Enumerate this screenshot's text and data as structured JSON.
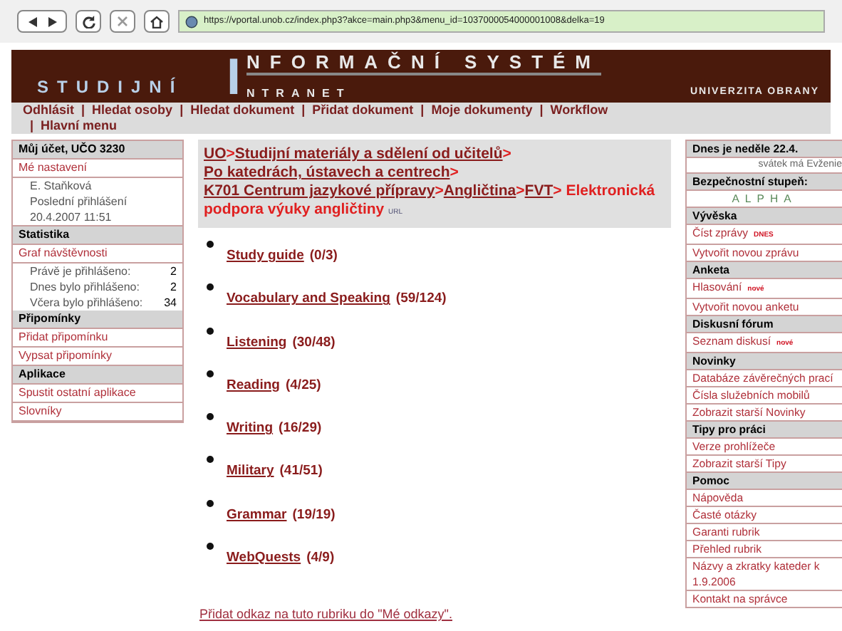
{
  "browser": {
    "url": "https://vportal.unob.cz/index.php3?akce=main.php3&menu_id=1037000054000001008&delka=19"
  },
  "banner": {
    "left": "STUDIJNÍ",
    "big_letter": "I",
    "top": "NFORMAČNÍ SYSTÉM",
    "bottom": "NTRANET",
    "right": "UNIVERZITA OBRANY"
  },
  "menu_separator": "|",
  "menu": [
    "Odhlásit",
    "Hledat osoby",
    "Hledat dokument",
    "Přidat dokument",
    "Moje dokumenty",
    "Workflow",
    "Hlavní menu"
  ],
  "left_sidebar": [
    {
      "kind": "header",
      "text": "Můj účet, UČO 3230"
    },
    {
      "kind": "link",
      "text": "Mé nastavení"
    },
    {
      "kind": "info",
      "lines": [
        "E. Staňková",
        "Poslední přihlášení",
        "20.4.2007 11:51"
      ]
    },
    {
      "kind": "header",
      "text": "Statistika"
    },
    {
      "kind": "link",
      "text": "Graf návštěvnosti"
    },
    {
      "kind": "stat",
      "label": "Právě je přihlášeno:",
      "value": "2"
    },
    {
      "kind": "stat",
      "label": "Dnes bylo přihlášeno:",
      "value": "2"
    },
    {
      "kind": "stat",
      "label": "Včera bylo přihlášeno:",
      "value": "34"
    },
    {
      "kind": "header",
      "text": "Připomínky"
    },
    {
      "kind": "link",
      "text": "Přidat připomínku"
    },
    {
      "kind": "link",
      "text": "Vypsat připomínky"
    },
    {
      "kind": "header",
      "text": "Aplikace"
    },
    {
      "kind": "link",
      "text": "Spustit ostatní aplikace"
    },
    {
      "kind": "link",
      "text": "Slovníky"
    }
  ],
  "breadcrumb": {
    "separator": ">",
    "links": [
      "UO",
      "Studijní materiály a sdělení od učitelů",
      "Po katedrách, ústavech a centrech",
      "K701 Centrum jazykové přípravy",
      "Angličtina",
      "FVT"
    ],
    "current": "Elektronická podpora výuky angličtiny",
    "tag": "URL"
  },
  "topics": [
    {
      "title": "Study guide",
      "count": "(0/3)"
    },
    {
      "title": "Vocabulary and Speaking",
      "count": "(59/124)"
    },
    {
      "title": "Listening",
      "count": "(30/48)"
    },
    {
      "title": "Reading",
      "count": "(4/25)"
    },
    {
      "title": "Writing",
      "count": "(16/29)"
    },
    {
      "title": "Military",
      "count": "(41/51)"
    },
    {
      "title": "Grammar",
      "count": "(19/19)"
    },
    {
      "title": "WebQuests",
      "count": "(4/9)"
    }
  ],
  "add_link": "Přidat odkaz na tuto rubriku do \"Mé odkazy\".",
  "right_sidebar": [
    {
      "kind": "header",
      "text": "Dnes je neděle 22.4."
    },
    {
      "kind": "note",
      "text": "svátek má Evženie"
    },
    {
      "kind": "header",
      "text": "Bezpečnostní stupeň:"
    },
    {
      "kind": "level",
      "text": "ALPHA"
    },
    {
      "kind": "header",
      "text": "Vývěska"
    },
    {
      "kind": "link",
      "text": "Číst zprávy",
      "badge": "DNES"
    },
    {
      "kind": "link",
      "text": "Vytvořit novou zprávu"
    },
    {
      "kind": "header",
      "text": "Anketa"
    },
    {
      "kind": "link",
      "text": "Hlasování",
      "badge": "nové"
    },
    {
      "kind": "link",
      "text": "Vytvořit novou anketu"
    },
    {
      "kind": "header",
      "text": "Diskusní fórum"
    },
    {
      "kind": "link",
      "text": "Seznam diskusí",
      "badge": "nové"
    },
    {
      "kind": "header",
      "text": "Novinky"
    },
    {
      "kind": "link",
      "text": "Databáze závěrečných prací"
    },
    {
      "kind": "link",
      "text": "Čísla služebních mobilů"
    },
    {
      "kind": "link",
      "text": "Zobrazit starší Novinky"
    },
    {
      "kind": "header",
      "text": "Tipy pro práci"
    },
    {
      "kind": "link",
      "text": "Verze prohlížeče"
    },
    {
      "kind": "link",
      "text": "Zobrazit starší Tipy"
    },
    {
      "kind": "header",
      "text": "Pomoc"
    },
    {
      "kind": "link",
      "text": "Nápověda"
    },
    {
      "kind": "link",
      "text": "Časté otázky"
    },
    {
      "kind": "link",
      "text": "Garanti rubrik"
    },
    {
      "kind": "link",
      "text": "Přehled rubrik"
    },
    {
      "kind": "link",
      "text": "Názvy a zkratky kateder k 1.9.2006"
    },
    {
      "kind": "link",
      "text": "Kontakt na správce"
    }
  ]
}
